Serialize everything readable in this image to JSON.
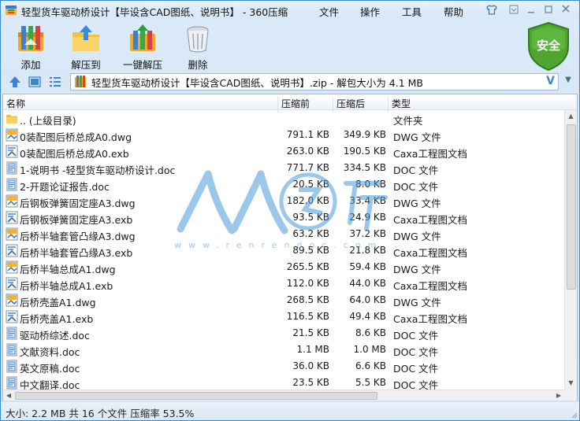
{
  "window": {
    "title": "轻型货车驱动桥设计【毕设含CAD图纸、说明书】 - 360压缩",
    "menu": [
      "文件",
      "操作",
      "工具",
      "帮助"
    ]
  },
  "toolbar": {
    "add_label": "添加",
    "extract_to_label": "解压到",
    "one_click_label": "一键解压",
    "delete_label": "删除"
  },
  "security": {
    "label": "安全"
  },
  "address": {
    "path": "轻型货车驱动桥设计【毕设含CAD图纸、说明书】.zip - 解包大小为 4.1 MB"
  },
  "columns": {
    "name": "名称",
    "size": "压缩前",
    "compressed": "压缩后",
    "type": "类型"
  },
  "files": [
    {
      "name": ".. (上级目录)",
      "size": "",
      "compressed": "",
      "type": "文件夹",
      "icon": "folder-icon"
    },
    {
      "name": "0装配图后桥总成A0.dwg",
      "size": "791.1 KB",
      "compressed": "349.9 KB",
      "type": "DWG 文件",
      "icon": "dwg-file-icon"
    },
    {
      "name": "0装配图后桥总成A0.exb",
      "size": "263.0 KB",
      "compressed": "190.5 KB",
      "type": "Caxa工程图文档",
      "icon": "exb-file-icon"
    },
    {
      "name": "1-说明书 -轻型货车驱动桥设计.doc",
      "size": "771.7 KB",
      "compressed": "334.5 KB",
      "type": "DOC 文件",
      "icon": "doc-file-icon"
    },
    {
      "name": "2-开题论证报告.doc",
      "size": "20.5 KB",
      "compressed": "8.0 KB",
      "type": "DOC 文件",
      "icon": "doc-file-icon"
    },
    {
      "name": "后钢板弹簧固定座A3.dwg",
      "size": "182.0 KB",
      "compressed": "33.4 KB",
      "type": "DWG 文件",
      "icon": "dwg-file-icon"
    },
    {
      "name": "后钢板弹簧固定座A3.exb",
      "size": "93.5 KB",
      "compressed": "24.9 KB",
      "type": "Caxa工程图文档",
      "icon": "exb-file-icon"
    },
    {
      "name": "后桥半轴套管凸缘A3.dwg",
      "size": "63.2 KB",
      "compressed": "37.2 KB",
      "type": "DWG 文件",
      "icon": "dwg-file-icon"
    },
    {
      "name": "后桥半轴套管凸缘A3.exb",
      "size": "89.5 KB",
      "compressed": "21.8 KB",
      "type": "Caxa工程图文档",
      "icon": "exb-file-icon"
    },
    {
      "name": "后桥半轴总成A1.dwg",
      "size": "265.5 KB",
      "compressed": "59.4 KB",
      "type": "DWG 文件",
      "icon": "dwg-file-icon"
    },
    {
      "name": "后桥半轴总成A1.exb",
      "size": "112.0 KB",
      "compressed": "44.0 KB",
      "type": "Caxa工程图文档",
      "icon": "exb-file-icon"
    },
    {
      "name": "后桥壳盖A1.dwg",
      "size": "268.5 KB",
      "compressed": "64.0 KB",
      "type": "DWG 文件",
      "icon": "dwg-file-icon"
    },
    {
      "name": "后桥壳盖A1.exb",
      "size": "116.5 KB",
      "compressed": "49.4 KB",
      "type": "Caxa工程图文档",
      "icon": "exb-file-icon"
    },
    {
      "name": "驱动桥综述.doc",
      "size": "21.5 KB",
      "compressed": "8.6 KB",
      "type": "DOC 文件",
      "icon": "doc-file-icon"
    },
    {
      "name": "文献资料.doc",
      "size": "1.1 MB",
      "compressed": "1.0 MB",
      "type": "DOC 文件",
      "icon": "doc-file-icon"
    },
    {
      "name": "英文原稿.doc",
      "size": "36.0 KB",
      "compressed": "6.6 KB",
      "type": "DOC 文件",
      "icon": "doc-file-icon"
    },
    {
      "name": "中文翻译.doc",
      "size": "23.5 KB",
      "compressed": "5.5 KB",
      "type": "DOC 文件",
      "icon": "doc-file-icon"
    }
  ],
  "status": {
    "text": "大小: 2.2 MB 共 16 个文件 压缩率 53.5%"
  },
  "watermark": {
    "url": "www.renrendoc.com"
  },
  "colors": {
    "accent": "#3e8ac9",
    "shield": "#4fa52f"
  }
}
